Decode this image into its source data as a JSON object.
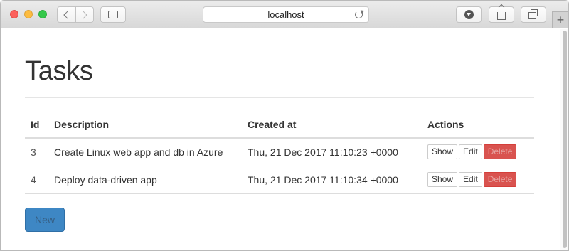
{
  "browser": {
    "url": "localhost",
    "new_tab_symbol": "+"
  },
  "page": {
    "title": "Tasks",
    "new_button": "New"
  },
  "table": {
    "headers": {
      "id": "Id",
      "description": "Description",
      "created_at": "Created at",
      "actions": "Actions"
    },
    "rows": [
      {
        "id": "3",
        "description": "Create Linux web app and db in Azure",
        "created_at": "Thu, 21 Dec 2017 11:10:23 +0000",
        "show": "Show",
        "edit": "Edit",
        "delete": "Delete"
      },
      {
        "id": "4",
        "description": "Deploy data-driven app",
        "created_at": "Thu, 21 Dec 2017 11:10:34 +0000",
        "show": "Show",
        "edit": "Edit",
        "delete": "Delete"
      }
    ]
  },
  "colors": {
    "primary_button": "#3e87c4",
    "danger_button": "#d9534f",
    "traffic_close": "#fc605c",
    "traffic_minimize": "#fdbc40",
    "traffic_maximize": "#34c84a"
  },
  "icons": [
    "close-traffic-light",
    "minimize-traffic-light",
    "maximize-traffic-light",
    "back-icon",
    "forward-icon",
    "sidebar-icon",
    "reload-icon",
    "download-icon",
    "share-icon",
    "tabs-icon",
    "new-tab-icon"
  ]
}
